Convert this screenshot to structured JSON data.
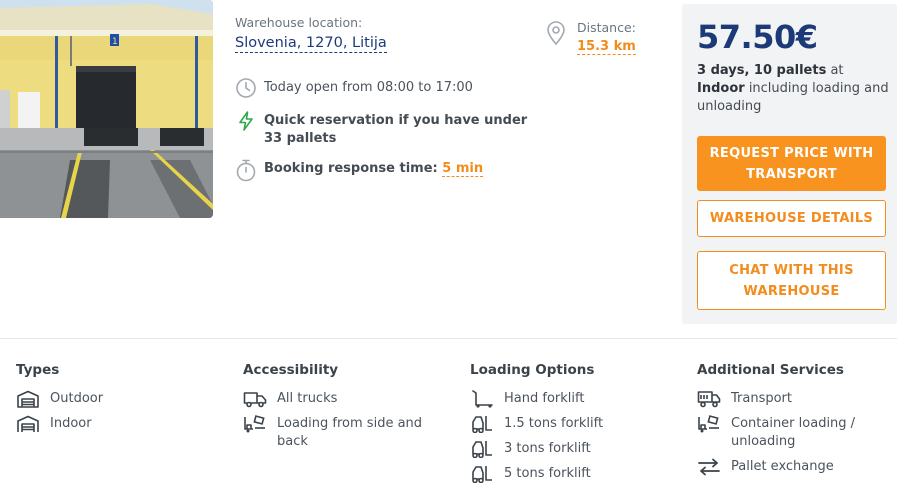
{
  "location": {
    "label": "Warehouse location:",
    "value": "Slovenia, 1270, Litija"
  },
  "distance": {
    "label": "Distance:",
    "value": "15.3 km"
  },
  "details": {
    "open_hours": "Today open from 08:00 to 17:00",
    "quick_reservation": "Quick reservation if you have under 33 pallets",
    "response_label": "Booking response time:",
    "response_value": "5 min"
  },
  "price_card": {
    "price": "57.50€",
    "summary_bold": "3 days, 10 pallets",
    "summary_at": "at",
    "summary_type": "Indoor",
    "summary_rest": "including loading and unloading",
    "request_button": "REQUEST PRICE WITH TRANSPORT",
    "details_button": "WAREHOUSE DETAILS",
    "chat_button": "CHAT WITH THIS WAREHOUSE"
  },
  "features": {
    "types": {
      "title": "Types",
      "items": [
        {
          "label": "Outdoor",
          "icon": "outdoor-warehouse-icon"
        },
        {
          "label": "Indoor",
          "icon": "indoor-warehouse-icon"
        }
      ]
    },
    "accessibility": {
      "title": "Accessibility",
      "items": [
        {
          "label": "All trucks",
          "icon": "truck-icon"
        },
        {
          "label": "Loading from side and back",
          "icon": "loading-icon"
        }
      ]
    },
    "loading_options": {
      "title": "Loading Options",
      "items": [
        {
          "label": "Hand forklift",
          "icon": "hand-forklift-icon"
        },
        {
          "label": "1.5 tons forklift",
          "icon": "forklift-icon"
        },
        {
          "label": "3 tons forklift",
          "icon": "forklift-icon"
        },
        {
          "label": "5 tons forklift",
          "icon": "forklift-icon"
        }
      ]
    },
    "additional_services": {
      "title": "Additional Services",
      "items": [
        {
          "label": "Transport",
          "icon": "transport-icon"
        },
        {
          "label": "Container loading / unloading",
          "icon": "container-loading-icon"
        },
        {
          "label": "Pallet exchange",
          "icon": "exchange-icon"
        }
      ]
    }
  },
  "colors": {
    "brand_blue": "#1d3a78",
    "accent_orange": "#f7931e",
    "quick_green": "#2fa84f",
    "card_bg": "#f2f3f5"
  }
}
